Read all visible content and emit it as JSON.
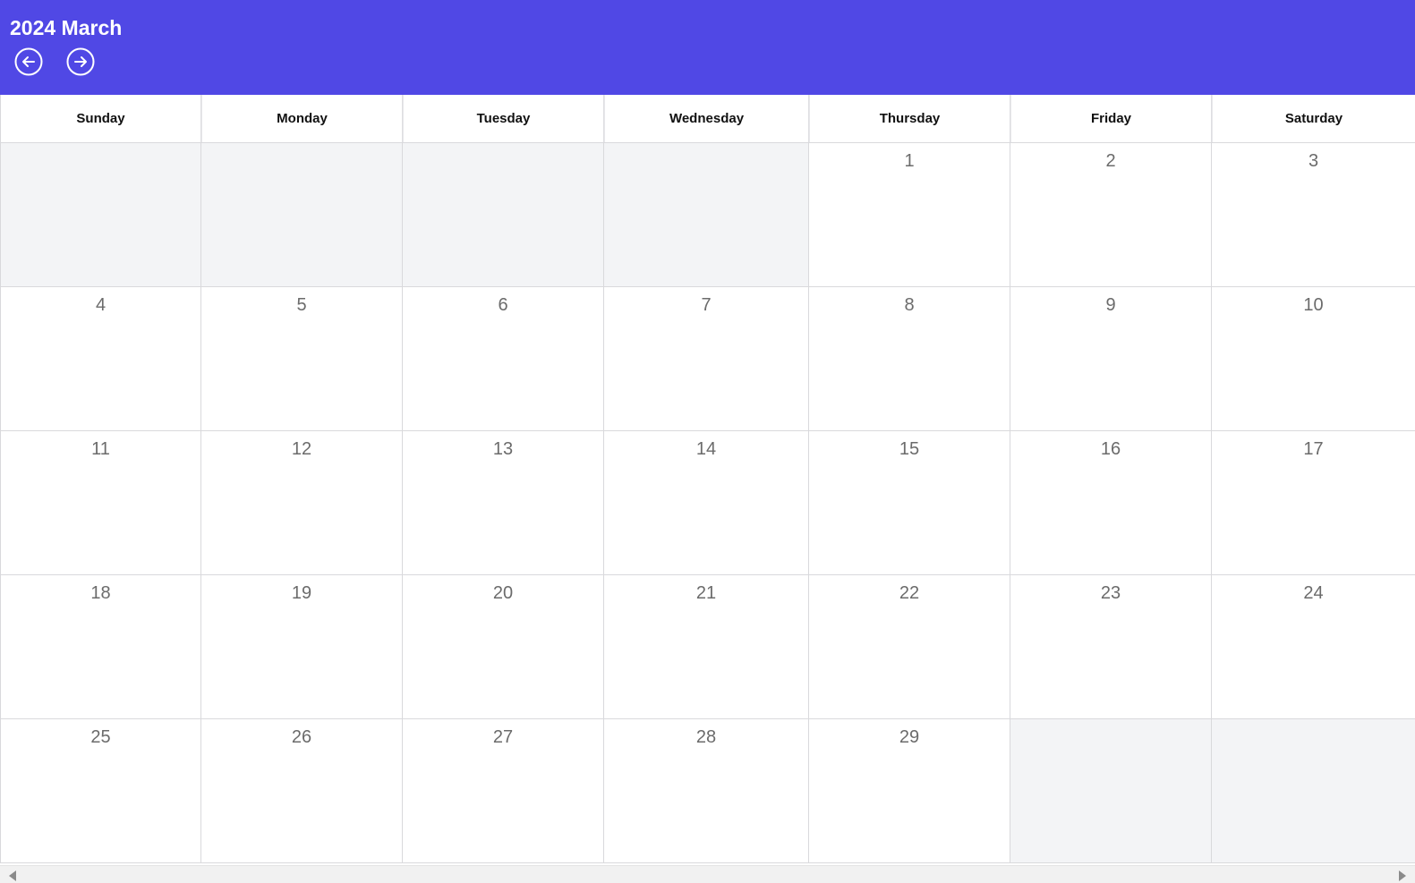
{
  "header": {
    "title": "2024 March",
    "prev_icon": "arrow-left-circle-icon",
    "next_icon": "arrow-right-circle-icon",
    "background_color": "#5048e5"
  },
  "calendar": {
    "weekdays": [
      "Sunday",
      "Monday",
      "Tuesday",
      "Wednesday",
      "Thursday",
      "Friday",
      "Saturday"
    ],
    "weeks": [
      [
        "",
        "",
        "",
        "",
        "1",
        "2",
        "3"
      ],
      [
        "4",
        "5",
        "6",
        "7",
        "8",
        "9",
        "10"
      ],
      [
        "11",
        "12",
        "13",
        "14",
        "15",
        "16",
        "17"
      ],
      [
        "18",
        "19",
        "20",
        "21",
        "22",
        "23",
        "24"
      ],
      [
        "25",
        "26",
        "27",
        "28",
        "29",
        "",
        ""
      ]
    ],
    "empty_cell_color": "#f3f4f6"
  },
  "scrollbar": {
    "left_icon": "scroll-left-arrow-icon",
    "right_icon": "scroll-right-arrow-icon"
  }
}
